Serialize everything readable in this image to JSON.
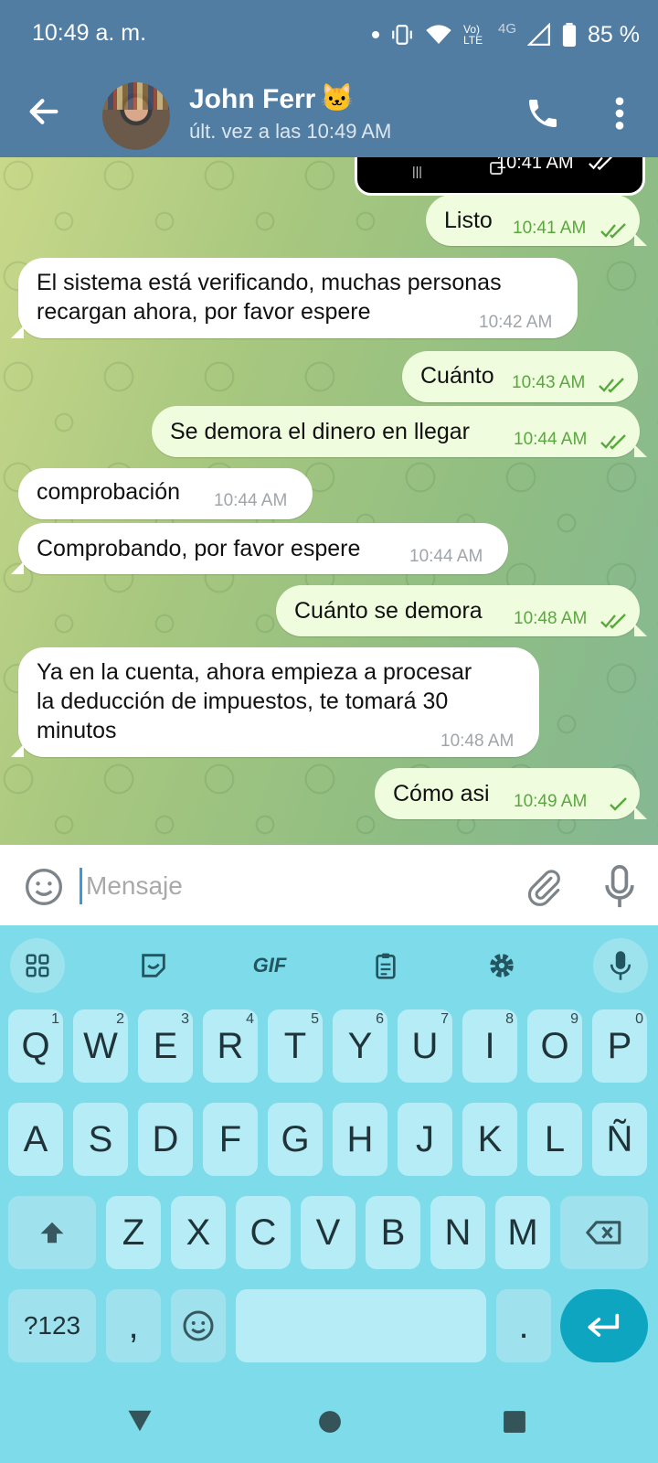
{
  "status_bar": {
    "time": "10:49 a. m.",
    "network": "4G",
    "volte": "Vo) LTE",
    "battery": "85 %"
  },
  "header": {
    "contact_name": "John Ferr",
    "name_emoji": "🐱",
    "last_seen": "últ. vez a las 10:49 AM",
    "icons": [
      "back-arrow-icon",
      "phone-icon",
      "more-vertical-icon"
    ]
  },
  "chat": {
    "previous_media_time": "10:41 AM",
    "messages": [
      {
        "dir": "out",
        "text": "Listo",
        "time": "10:41 AM",
        "status": "read"
      },
      {
        "dir": "in",
        "lines": [
          "El sistema está verificando, muchas personas",
          "recargan ahora, por favor espere"
        ],
        "time": "10:42 AM"
      },
      {
        "dir": "out",
        "text": "Cuánto",
        "time": "10:43 AM",
        "status": "read"
      },
      {
        "dir": "out",
        "text": "Se demora el dinero en llegar",
        "time": "10:44 AM",
        "status": "read"
      },
      {
        "dir": "in",
        "text": "comprobación",
        "time": "10:44 AM"
      },
      {
        "dir": "in",
        "text": "Comprobando, por favor espere",
        "time": "10:44 AM"
      },
      {
        "dir": "out",
        "text": "Cuánto se demora",
        "time": "10:48 AM",
        "status": "read"
      },
      {
        "dir": "in",
        "lines": [
          "Ya en la cuenta, ahora empieza a procesar",
          "la deducción de impuestos, te tomará 30",
          "minutos"
        ],
        "time": "10:48 AM"
      },
      {
        "dir": "out",
        "text": "Cómo asi",
        "time": "10:49 AM",
        "status": "sent"
      }
    ]
  },
  "input": {
    "placeholder": "Mensaje"
  },
  "keyboard": {
    "toolbar": {
      "gif": "GIF"
    },
    "row1": [
      {
        "k": "Q",
        "h": "1"
      },
      {
        "k": "W",
        "h": "2"
      },
      {
        "k": "E",
        "h": "3"
      },
      {
        "k": "R",
        "h": "4"
      },
      {
        "k": "T",
        "h": "5"
      },
      {
        "k": "Y",
        "h": "6"
      },
      {
        "k": "U",
        "h": "7"
      },
      {
        "k": "I",
        "h": "8"
      },
      {
        "k": "O",
        "h": "9"
      },
      {
        "k": "P",
        "h": "0"
      }
    ],
    "row2": [
      "A",
      "S",
      "D",
      "F",
      "G",
      "H",
      "J",
      "K",
      "L",
      "Ñ"
    ],
    "row3": [
      "Z",
      "X",
      "C",
      "V",
      "B",
      "N",
      "M"
    ],
    "symbols": "?123",
    "comma": ",",
    "period": "."
  }
}
